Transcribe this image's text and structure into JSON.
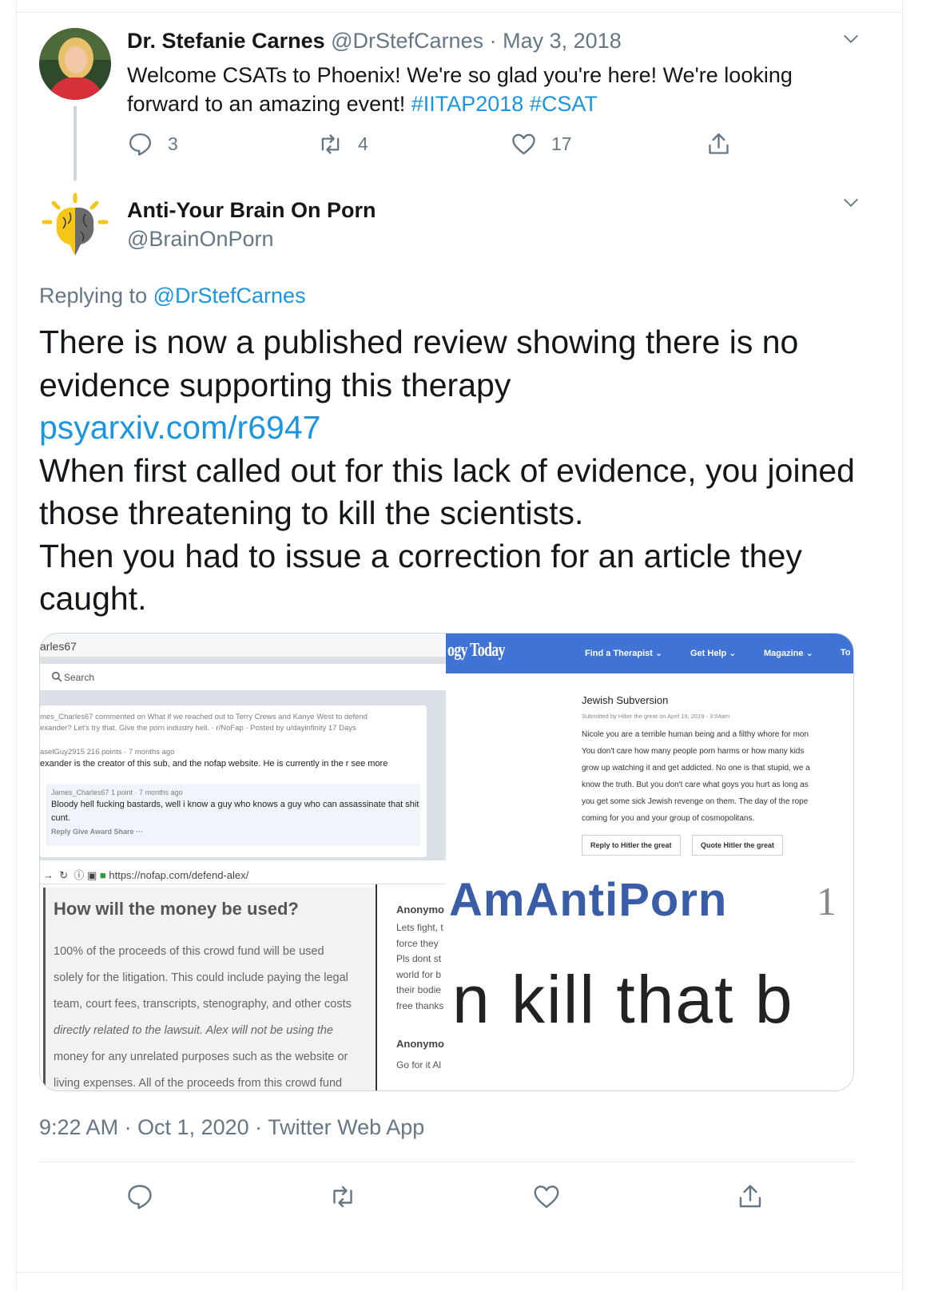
{
  "parent_tweet": {
    "name": "Dr. Stefanie Carnes",
    "handle": "@DrStefCarnes",
    "dot": "·",
    "date": "May 3, 2018",
    "text_before": "Welcome CSATs to Phoenix! We're so glad you're here! We're looking forward to an amazing event!",
    "hashtags": "#IITAP2018 #CSAT",
    "replies": "3",
    "retweets": "4",
    "likes": "17"
  },
  "tweet": {
    "name": "Anti-Your Brain On Porn",
    "handle": "@BrainOnPorn",
    "replying_label": "Replying to",
    "replying_handle": "@DrStefCarnes",
    "line1": "There is now a published review showing there is no evidence supporting this therapy",
    "link": "psyarxiv.com/r6947",
    "line2": "When first called out for this lack of evidence, you joined those threatening to kill the scientists.",
    "line3": "Then you had to issue a correction for an article they caught.",
    "timestamp": "9:22 AM · Oct 1, 2020 · Twitter Web App"
  },
  "media": {
    "reddit": {
      "title": "arles67",
      "search": "Search",
      "line1": "mes_Charles67 commented on What if we reached out to Terry Crews and Kanye West to defend",
      "line2": "exander? Let's try that. Give the porn industry hell. · r/NoFap · Posted by u/dayinfinity 17 Days",
      "line3": "aselGuy2915 216 points · 7 months ago",
      "line4": "exander is the creator of this sub, and the nofap website. He is currently in the r  see more",
      "nested_meta": "James_Charles67 1 point · 7 months ago",
      "nested_text": "Bloody hell fucking bastards, well i know a guy who knows a guy who can assassinate that shit cunt.",
      "nested_actions": "Reply   Give Award   Share   ···"
    },
    "pt": {
      "logo": "ogy Today",
      "nav": [
        "Find a Therapist ⌄",
        "Get Help ⌄",
        "Magazine ⌄",
        "To"
      ],
      "heading": "Jewish Subversion",
      "sub": "Submitted by Hitler the great on April 19, 2019 - 3:04am",
      "body": [
        "Nicole you are a terrible human being and a filthy whore for mon",
        "You don't care how many people porn harms or how many kids",
        "grow up watching it and get addicted. No one is that stupid, we a",
        "know the truth. But you don't care what goys you hurt as long as",
        "you get some sick Jewish revenge on them. The day of the rope",
        "coming for you and your group of cosmopolitans."
      ],
      "btn1": "Reply to Hitler the great",
      "btn2": "Quote Hitler the great"
    },
    "nofap": {
      "url": "https://nofap.com/defend-alex/",
      "heading": "How will the money be used?",
      "lines": [
        "100% of the proceeds of this crowd fund will be used",
        "solely for the litigation. This could include paying the legal",
        "team, court fees, transcripts, stenography, and other costs",
        "directly related to the lawsuit. Alex will not be using the",
        "money for any unrelated purposes such as the website or",
        "living expenses. All of the proceeds from this crowd fund"
      ],
      "side_name1": "Anonymo",
      "side_lines": [
        "Lets fight, t",
        "force they",
        "Pls dont st",
        "world for b",
        "their bodie",
        "free thanks"
      ],
      "side_name2": "Anonymo",
      "side_last": "Go for it Al"
    },
    "comment": {
      "name": "AmAntiPorn",
      "num": "1",
      "text": "n kill that b"
    }
  },
  "colors": {
    "link": "#1b95e0",
    "secondary": "#657786",
    "pt_blue": "#3f74d6"
  },
  "icons": [
    "reply-icon",
    "retweet-icon",
    "like-icon",
    "share-icon",
    "chevron-down-icon",
    "search-icon",
    "lock-icon"
  ]
}
